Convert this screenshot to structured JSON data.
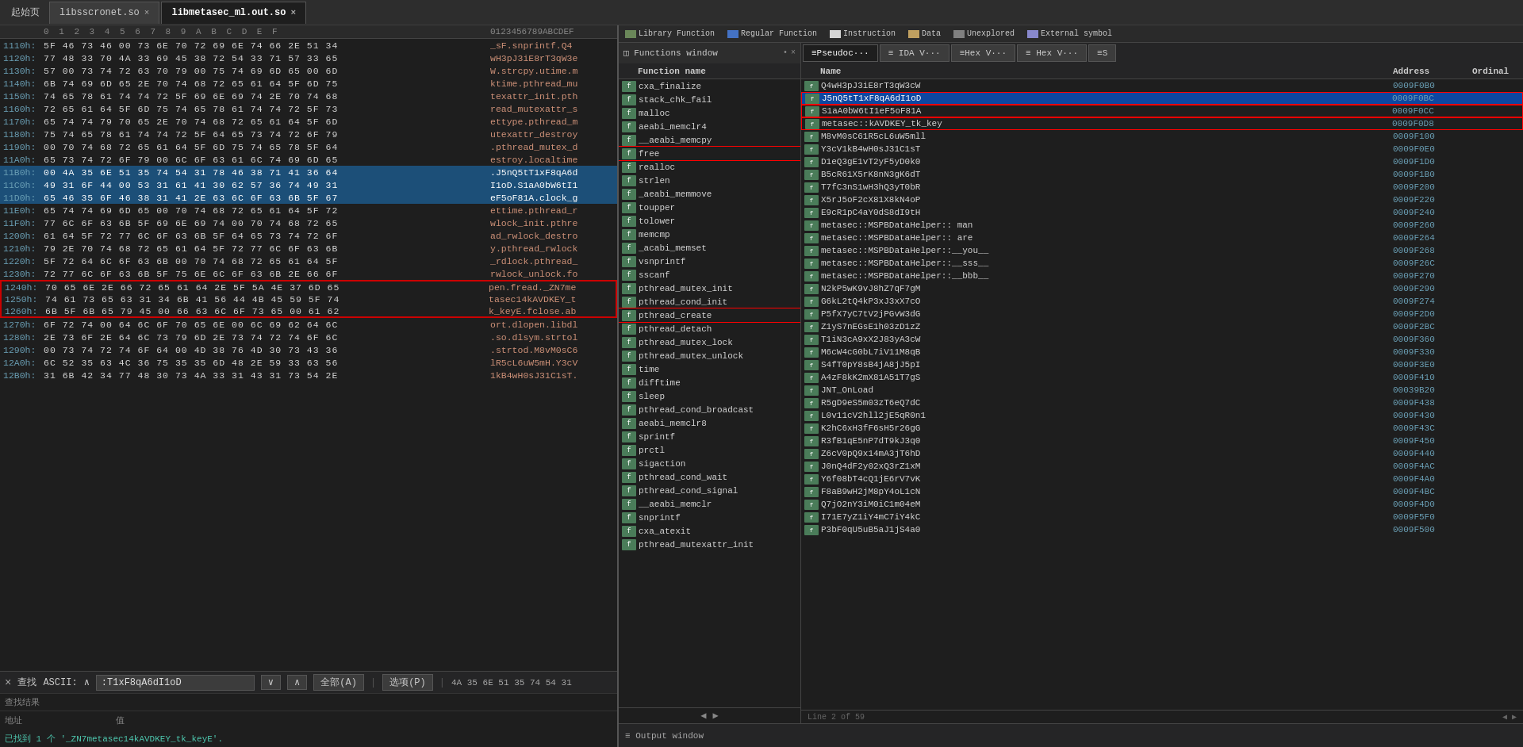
{
  "tabs": {
    "home": "起始页",
    "tab1": {
      "label": "libsscronet.so",
      "closable": true
    },
    "tab2": {
      "label": "libmetasec_ml.out.so",
      "closable": true,
      "active": true
    }
  },
  "hex_header": {
    "columns": "0  1  2  3  4  5  6  7  8  9  A  B  C  D  E  F",
    "ascii": "0123456789ABCDEF"
  },
  "hex_rows": [
    {
      "addr": "1110h:",
      "bytes": "5F 46 73 46 00 73 6E 70 72 69 6E 74 66 2E 51 34",
      "ascii": "_sF.snprintf.Q4",
      "highlight": ""
    },
    {
      "addr": "1120h:",
      "bytes": "77 48 33 70 4A 33 69 45 38 72 54 33 71 57 33 65",
      "ascii": "wH3pJ3iE8rT3qW3e",
      "highlight": ""
    },
    {
      "addr": "1130h:",
      "bytes": "57 00 73 74 72 63 70 79 00 75 74 69 6D 65 00 6D",
      "ascii": "W.strcpy.utime.m",
      "highlight": ""
    },
    {
      "addr": "1140h:",
      "bytes": "6B 74 69 6D 65 2E 70 74 68 72 65 61 64 5F 6D 75",
      "ascii": "ktime.pthread_mu",
      "highlight": ""
    },
    {
      "addr": "1150h:",
      "bytes": "74 65 78 61 74 74 72 5F 69 6E 69 74 2E 70 74 68",
      "ascii": "texattr_init.pth",
      "highlight": ""
    },
    {
      "addr": "1160h:",
      "bytes": "72 65 61 64 5F 6D 75 74 65 78 61 74 74 72 5F 73",
      "ascii": "read_mutexattr_s",
      "highlight": ""
    },
    {
      "addr": "1170h:",
      "bytes": "65 74 74 79 70 65 2E 70 74 68 72 65 61 64 5F 6D",
      "ascii": "ettype.pthread_m",
      "highlight": ""
    },
    {
      "addr": "1180h:",
      "bytes": "75 74 65 78 61 74 74 72 5F 64 65 73 74 72 6F 79",
      "ascii": "utexattr_destroy",
      "highlight": ""
    },
    {
      "addr": "1190h:",
      "bytes": "00 70 74 68 72 65 61 64 5F 6D 75 74 65 78 5F 64",
      "ascii": ".pthread_mutex_d",
      "highlight": ""
    },
    {
      "addr": "11A0h:",
      "bytes": "65 73 74 72 6F 79 00 6C 6F 63 61 6C 74 69 6D 65",
      "ascii": "estroy.localtime",
      "highlight": ""
    },
    {
      "addr": "11B0h:",
      "bytes": "00 4A 35 6E 51 35 74 54 31 78 46 38 71 41 36 64",
      "ascii": ".J5nQ5tT1xF8qA6d",
      "highlight": "selected-blue"
    },
    {
      "addr": "11C0h:",
      "bytes": "49 31 6F 44 00 53 31 61 41 30 62 57 36 74 49 31",
      "ascii": "I1oD.S1aA0bW6tI1",
      "highlight": "selected-blue"
    },
    {
      "addr": "11D0h:",
      "bytes": "65 46 35 6F 46 38 31 41 2E 63 6C 6F 63 6B 5F 67",
      "ascii": "eF5oF81A.clock_g",
      "highlight": "selected-blue"
    },
    {
      "addr": "11E0h:",
      "bytes": "65 74 74 69 6D 65 00 70 74 68 72 65 61 64 5F 72",
      "ascii": "ettime.pthread_r",
      "highlight": ""
    },
    {
      "addr": "11F0h:",
      "bytes": "77 6C 6F 63 6B 5F 69 6E 69 74 00 70 74 68 72 65",
      "ascii": "wlock_init.pthre",
      "highlight": ""
    },
    {
      "addr": "1200h:",
      "bytes": "61 64 5F 72 77 6C 6F 63 6B 5F 64 65 73 74 72 6F",
      "ascii": "ad_rwlock_destro",
      "highlight": ""
    },
    {
      "addr": "1210h:",
      "bytes": "79 2E 70 74 68 72 65 61 64 5F 72 77 6C 6F 63 6B",
      "ascii": "y.pthread_rwlock",
      "highlight": ""
    },
    {
      "addr": "1220h:",
      "bytes": "5F 72 64 6C 6F 63 6B 00 70 74 68 72 65 61 64 5F",
      "ascii": "_rdlock.pthread_",
      "highlight": ""
    },
    {
      "addr": "1230h:",
      "bytes": "72 77 6C 6F 63 6B 5F 75 6E 6C 6F 63 6B 2E 66 6F",
      "ascii": "rwlock_unlock.fo",
      "highlight": ""
    },
    {
      "addr": "1240h:",
      "bytes": "70 65 6E 2E 66 72 65 61 64 2E 5F 5A 4E 37 6D 65",
      "ascii": "pen.fread._ZN7me",
      "highlight": "red-box"
    },
    {
      "addr": "1250h:",
      "bytes": "74 61 73 65 63 31 34 6B 41 56 44 4B 45 59 5F 74",
      "ascii": "tasec14kAVDKEY_t",
      "highlight": "red-box"
    },
    {
      "addr": "1260h:",
      "bytes": "6B 5F 6B 65 79 45 00 66 63 6C 6F 73 65 00 61 62",
      "ascii": "k_keyE.fclose.ab",
      "highlight": "red-box"
    },
    {
      "addr": "1270h:",
      "bytes": "6F 72 74 00 64 6C 6F 70 65 6E 00 6C 69 62 64 6C",
      "ascii": "ort.dlopen.libdl",
      "highlight": ""
    },
    {
      "addr": "1280h:",
      "bytes": "2E 73 6F 2E 64 6C 73 79 6D 2E 73 74 72 74 6F 6C",
      "ascii": ".so.dlsym.strtol",
      "highlight": ""
    },
    {
      "addr": "1290h:",
      "bytes": "00 73 74 72 74 6F 64 00 4D 38 76 4D 30 73 43 36",
      "ascii": ".strtod.M8vM0sC6",
      "highlight": ""
    },
    {
      "addr": "12A0h:",
      "bytes": "6C 52 35 63 4C 36 75 35 35 6D 48 2E 59 33 63 56",
      "ascii": "lR5cL6uW5mH.Y3cV",
      "highlight": ""
    },
    {
      "addr": "12B0h:",
      "bytes": "31 6B 42 34 77 48 30 73 4A 33 31 43 31 73 54 2E",
      "ascii": "1kB4wH0sJ31C1sT.",
      "highlight": ""
    }
  ],
  "search_bar": {
    "close_label": "×",
    "label": "查找",
    "mode": "ASCII:",
    "input_value": ":T1xF8qA6dI1oD",
    "all_label": "全部(A)",
    "options_label": "选项(P)",
    "separator": "|",
    "hex_bytes": "4A 35 6E 51 35 74 54 31"
  },
  "search_result": {
    "label": "查找结果",
    "found_text": "已找到 1 个 '_ZN7metasec14kAVDKEY_tk_keyE'.",
    "addr_label": "地址",
    "val_label": "值"
  },
  "legend": {
    "items": [
      {
        "label": "Library Function",
        "color": "#6a8759"
      },
      {
        "label": "Regular Function",
        "color": "#4472c4"
      },
      {
        "label": "Instruction",
        "color": "#d4d4d4"
      },
      {
        "label": "Data",
        "color": "#c0a060"
      },
      {
        "label": "Unexplored",
        "color": "#808080"
      },
      {
        "label": "External symbol",
        "color": "#8888cc"
      }
    ]
  },
  "sub_tabs": {
    "active": "pseudocode",
    "items": [
      {
        "id": "pseudocode",
        "label": "≡Pseudoc···"
      },
      {
        "id": "ida",
        "label": "≡ IDA V···"
      },
      {
        "id": "hex1",
        "label": "≡Hex V···"
      },
      {
        "id": "hex2",
        "label": "≡ Hex V···"
      },
      {
        "id": "s",
        "label": "≡S"
      }
    ]
  },
  "functions_window": {
    "title": "Functions window",
    "header": {
      "name": "Function name"
    },
    "items": [
      {
        "name": "cxa_finalize",
        "icon": "f",
        "selected": false
      },
      {
        "name": "stack_chk_fail",
        "icon": "f",
        "selected": false
      },
      {
        "name": "malloc",
        "icon": "f",
        "selected": false
      },
      {
        "name": "aeabi_memclr4",
        "icon": "f",
        "selected": false
      },
      {
        "name": "__aeabi_memcpy",
        "icon": "f",
        "selected": false
      },
      {
        "name": "free",
        "icon": "f",
        "selected": false,
        "highlight_red": true
      },
      {
        "name": "realloc",
        "icon": "f",
        "selected": false
      },
      {
        "name": "strlen",
        "icon": "f",
        "selected": false
      },
      {
        "name": "_aeabi_memmove",
        "icon": "f",
        "selected": false
      },
      {
        "name": "toupper",
        "icon": "f",
        "selected": false
      },
      {
        "name": "tolower",
        "icon": "f",
        "selected": false
      },
      {
        "name": "memcmp",
        "icon": "f",
        "selected": false
      },
      {
        "name": "_acabi_memset",
        "icon": "f",
        "selected": false
      },
      {
        "name": "vsnprintf",
        "icon": "f",
        "selected": false
      },
      {
        "name": "sscanf",
        "icon": "f",
        "selected": false
      },
      {
        "name": "pthread_mutex_init",
        "icon": "f",
        "selected": false
      },
      {
        "name": "pthread_cond_init",
        "icon": "f",
        "selected": false
      },
      {
        "name": "pthread_create",
        "icon": "f",
        "selected": false,
        "highlight_red": true
      },
      {
        "name": "pthread_detach",
        "icon": "f",
        "selected": false
      },
      {
        "name": "pthread_mutex_lock",
        "icon": "f",
        "selected": false
      },
      {
        "name": "pthread_mutex_unlock",
        "icon": "f",
        "selected": false
      },
      {
        "name": "time",
        "icon": "f",
        "selected": false
      },
      {
        "name": "difftime",
        "icon": "f",
        "selected": false
      },
      {
        "name": "sleep",
        "icon": "f",
        "selected": false
      },
      {
        "name": "pthread_cond_broadcast",
        "icon": "f",
        "selected": false
      },
      {
        "name": "aeabi_memclr8",
        "icon": "f",
        "selected": false
      },
      {
        "name": "sprintf",
        "icon": "f",
        "selected": false
      },
      {
        "name": "prctl",
        "icon": "f",
        "selected": false
      },
      {
        "name": "sigaction",
        "icon": "f",
        "selected": false
      },
      {
        "name": "pthread_cond_wait",
        "icon": "f",
        "selected": false
      },
      {
        "name": "pthread_cond_signal",
        "icon": "f",
        "selected": false
      },
      {
        "name": "__aeabi_memclr",
        "icon": "f",
        "selected": false
      },
      {
        "name": "snprintf",
        "icon": "f",
        "selected": false
      },
      {
        "name": "cxa_atexit",
        "icon": "f",
        "selected": false
      },
      {
        "name": "pthread_mutexattr_init",
        "icon": "f",
        "selected": false
      }
    ]
  },
  "names_window": {
    "title": "Name",
    "headers": {
      "name": "Name",
      "address": "Address",
      "ordinal": "Ordinal"
    },
    "items": [
      {
        "name": "Q4wH3pJ3iE8rT3qW3cW",
        "addr": "0009F0B0",
        "ordinal": "",
        "icon": "f",
        "selected": false
      },
      {
        "name": "J5nQ5tT1xF8qA6dI1oD",
        "addr": "0009F0BC",
        "ordinal": "",
        "icon": "f",
        "selected": true,
        "highlight_red": true
      },
      {
        "name": "S1aA0bW6tI1eF5oF81A",
        "addr": "0009F0CC",
        "ordinal": "",
        "icon": "f",
        "selected": false,
        "highlight_red": true
      },
      {
        "name": "metasec::kAVDKEY_tk_key",
        "addr": "0009F0D8",
        "ordinal": "",
        "icon": "f",
        "selected": false,
        "highlight_red": true
      },
      {
        "name": "M8vM0sC61R5cL6uW5mll",
        "addr": "0009F100",
        "ordinal": "",
        "icon": "f",
        "selected": false
      },
      {
        "name": "Y3cV1kB4wH0sJ31C1sT",
        "addr": "0009F0E0",
        "ordinal": "",
        "icon": "f",
        "selected": false
      },
      {
        "name": "D1eQ3gE1vT2yF5yD0k0",
        "addr": "0009F1D0",
        "ordinal": "",
        "icon": "f",
        "selected": false
      },
      {
        "name": "B5cR61X5rK8nN3gK6dT",
        "addr": "0009F1B0",
        "ordinal": "",
        "icon": "f",
        "selected": false
      },
      {
        "name": "T7fC3nS1wH3hQ3yT0bR",
        "addr": "0009F200",
        "ordinal": "",
        "icon": "f",
        "selected": false
      },
      {
        "name": "X5rJ5oF2cX81X8kN4oP",
        "addr": "0009F220",
        "ordinal": "",
        "icon": "f",
        "selected": false
      },
      {
        "name": "E9cR1pC4aY0dS8dI9tH",
        "addr": "0009F240",
        "ordinal": "",
        "icon": "f",
        "selected": false
      },
      {
        "name": "metasec::MSPBDataHelper:: man",
        "addr": "0009F260",
        "ordinal": "",
        "icon": "f",
        "selected": false
      },
      {
        "name": "metasec::MSPBDataHelper:: are",
        "addr": "0009F264",
        "ordinal": "",
        "icon": "f",
        "selected": false
      },
      {
        "name": "metasec::MSPBDataHelper::__you__",
        "addr": "0009F268",
        "ordinal": "",
        "icon": "f",
        "selected": false
      },
      {
        "name": "metasec::MSPBDataHelper::__sss__",
        "addr": "0009F26C",
        "ordinal": "",
        "icon": "f",
        "selected": false
      },
      {
        "name": "metasec::MSPBDataHelper::__bbb__",
        "addr": "0009F270",
        "ordinal": "",
        "icon": "f",
        "selected": false
      },
      {
        "name": "N2kP5wK9vJ8hZ7qF7gM",
        "addr": "0009F290",
        "ordinal": "",
        "icon": "f",
        "selected": false
      },
      {
        "name": "G6kL2tQ4kP3xJ3xX7cO",
        "addr": "0009F274",
        "ordinal": "",
        "icon": "f",
        "selected": false
      },
      {
        "name": "P5fX7yC7tV2jPGvW3dG",
        "addr": "0009F2D0",
        "ordinal": "",
        "icon": "f",
        "selected": false
      },
      {
        "name": "Z1yS7nEGsE1h03zD1zZ",
        "addr": "0009F2BC",
        "ordinal": "",
        "icon": "f",
        "selected": false
      },
      {
        "name": "T1iN3cA9xX2J83yA3cW",
        "addr": "0009F360",
        "ordinal": "",
        "icon": "f",
        "selected": false
      },
      {
        "name": "M6cW4cG0bL7iV11M8qB",
        "addr": "0009F330",
        "ordinal": "",
        "icon": "f",
        "selected": false
      },
      {
        "name": "S4fT0pY8sB4jA8jJ5pI",
        "addr": "0009F3E0",
        "ordinal": "",
        "icon": "f",
        "selected": false
      },
      {
        "name": "A4zF8kK2mX81A51T7gS",
        "addr": "0009F410",
        "ordinal": "",
        "icon": "f",
        "selected": false
      },
      {
        "name": "JNT_OnLoad",
        "addr": "00039B20",
        "ordinal": "",
        "icon": "f",
        "selected": false
      },
      {
        "name": "R5gD9eS5m03zT6eQ7dC",
        "addr": "0009F438",
        "ordinal": "",
        "icon": "f",
        "selected": false
      },
      {
        "name": "L0v11cV2hll2jE5qR0n1",
        "addr": "0009F430",
        "ordinal": "",
        "icon": "f",
        "selected": false
      },
      {
        "name": "K2hC6xH3fF6sH5r26gG",
        "addr": "0009F43C",
        "ordinal": "",
        "icon": "f",
        "selected": false
      },
      {
        "name": "R3fB1qE5nP7dT9kJ3q0",
        "addr": "0009F450",
        "ordinal": "",
        "icon": "f",
        "selected": false
      },
      {
        "name": "Z6cV0pQ9x14mA3jT6hD",
        "addr": "0009F440",
        "ordinal": "",
        "icon": "f",
        "selected": false
      },
      {
        "name": "J0nQ4dF2y02xQ3rZ1xM",
        "addr": "0009F4AC",
        "ordinal": "",
        "icon": "f",
        "selected": false
      },
      {
        "name": "Y6f08bT4cQ1jE6rV7vK",
        "addr": "0009F4A0",
        "ordinal": "",
        "icon": "f",
        "selected": false
      },
      {
        "name": "F8aB9wH2jM8pY4oL1cN",
        "addr": "0009F4BC",
        "ordinal": "",
        "icon": "f",
        "selected": false
      },
      {
        "name": "Q7jO2nY3iM0iC1m04eM",
        "addr": "0009F4D0",
        "ordinal": "",
        "icon": "f",
        "selected": false
      },
      {
        "name": "I71E7yZ1iY4mC7iY4kC",
        "addr": "0009F5F0",
        "ordinal": "",
        "icon": "f",
        "selected": false
      },
      {
        "name": "P3bF0qU5uB5aJ1jS4a0",
        "addr": "0009F500",
        "ordinal": "",
        "icon": "f",
        "selected": false
      }
    ],
    "line_info": "Line 2 of 59"
  },
  "output_window": {
    "label": "≡ Output window"
  }
}
